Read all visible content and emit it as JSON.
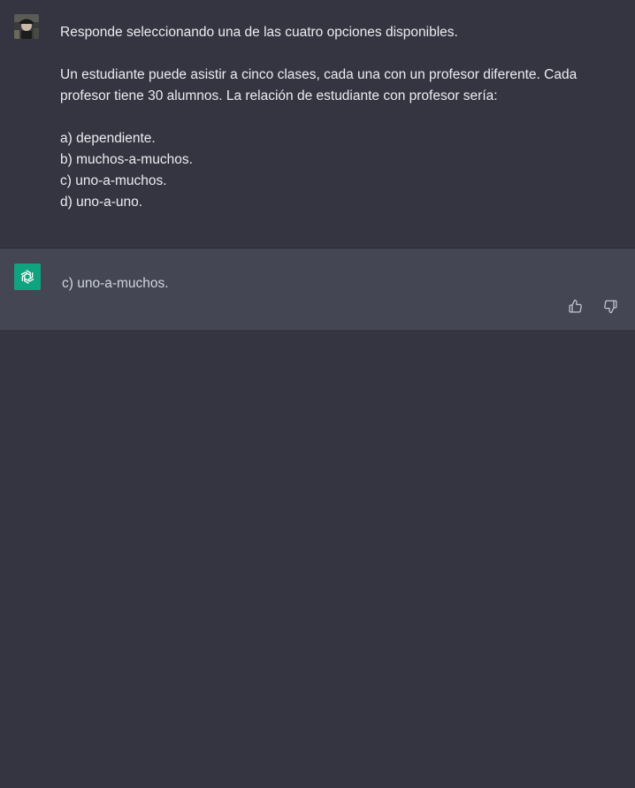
{
  "user_message": {
    "avatar_icon": "user-avatar-photo",
    "intro": "Responde seleccionando una de las cuatro opciones disponibles.",
    "question": "Un estudiante puede asistir a cinco clases, cada una con un profesor diferente. Cada profesor tiene 30 alumnos. La relación de estudiante con profesor sería:",
    "options": [
      "a) dependiente.",
      "b) muchos-a-muchos.",
      "c) uno-a-muchos.",
      "d) uno-a-uno."
    ]
  },
  "assistant_message": {
    "logo_icon": "openai-logo-icon",
    "logo_color": "#10a37f",
    "answer": "c) uno-a-muchos.",
    "feedback": {
      "thumbs_up_icon": "thumbs-up-icon",
      "thumbs_down_icon": "thumbs-down-icon"
    }
  },
  "colors": {
    "background": "#343541",
    "assistant_background": "#444654",
    "text": "#ececf1"
  }
}
